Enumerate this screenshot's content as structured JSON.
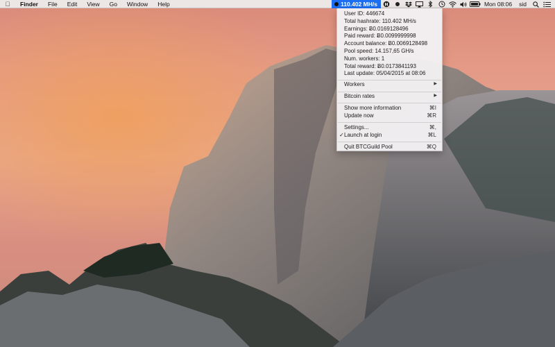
{
  "menubar": {
    "app_name": "Finder",
    "menus": [
      "File",
      "Edit",
      "View",
      "Go",
      "Window",
      "Help"
    ],
    "status_hashrate": "110.402 MH/s",
    "clock": "Mon 08:06",
    "user": "sid"
  },
  "dropdown": {
    "info": [
      "User ID: 446674",
      "Total hashrate: 110.402 MH/s",
      "Earnings: Ƀ0.0169128496",
      "Paid reward: Ƀ0.0099999998",
      "Account balance: Ƀ0.0069128498",
      "Pool speed: 14.157,65 GH/s",
      "Num. workers: 1",
      "Total reward: Ƀ0.0173841193",
      "Last update: 05/04/2015 at 08:06"
    ],
    "workers_label": "Workers",
    "bitcoin_rates_label": "Bitcoin rates",
    "show_more_label": "Show more information",
    "show_more_shortcut": "⌘I",
    "update_now_label": "Update now",
    "update_now_shortcut": "⌘R",
    "settings_label": "Settings...",
    "settings_shortcut": "⌘,",
    "launch_at_login_label": "Launch at login",
    "launch_at_login_checked": true,
    "launch_at_login_shortcut": "⌘L",
    "quit_label": "Quit BTCGuild Pool",
    "quit_shortcut": "⌘Q"
  }
}
